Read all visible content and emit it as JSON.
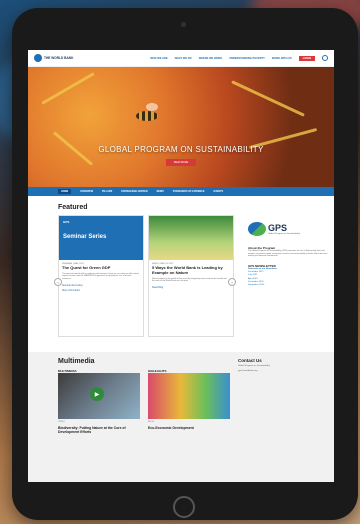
{
  "header": {
    "logo_text": "THE WORLD BANK",
    "nav": [
      "WHO WE ARE",
      "WHAT WE DO",
      "WHERE WE WORK",
      "UNDERSTANDING POVERTY",
      "WORK WITH US"
    ],
    "donate": "LOGIN"
  },
  "hero": {
    "title": "GLOBAL PROGRAM ON SUSTAINABILITY",
    "button": "READ MORE"
  },
  "subnav": [
    "HOME",
    "OVERVIEW",
    "PILLARS",
    "KNOWLEDGE CENTER",
    "NEWS",
    "STANDARDS OF EVIDENCE",
    "EVENTS"
  ],
  "featured": {
    "title": "Featured",
    "cards": [
      {
        "badge": "GPS",
        "image_text": "Seminar Series",
        "meta": "WEBINAR | MAY 2021",
        "title": "The Quest for Green GDP",
        "body": "The seminar formed with an audience with interest in how we can advance with natural capital accounts and the WAVES/GPS approach to adjusting for use of natural resources.",
        "link1": "Seminar Recording",
        "link2": "More Information"
      },
      {
        "meta": "NEWS | MAY 20 2021",
        "title": "5 Ways the World Bank is Leading by Example on Nature",
        "body": "Natural capital is the wealth of the poor. By integrating nature and natural capital into the work of the World Bank we can grow.",
        "link1": "Read Blog"
      }
    ]
  },
  "sidebar": {
    "gps_word": "GPS",
    "gps_sub": "Global Program on Sustainability",
    "about_title": "About the Program",
    "about_text": "The Global Program on Sustainability (GPS) promotes the use of high-quality data and analysis on natural capital, ecosystem services and sustainability to better inform decision making and financial investments.",
    "newsletter_title": "GPS NEWSLETTER",
    "subscribe": "Subscribe to our Newsletter",
    "issues": [
      "December 2021",
      "July 2021",
      "April 2021",
      "December 2020",
      "September 2020"
    ]
  },
  "multimedia": {
    "title": "Multimedia",
    "col1_label": "MULTIMEDIA",
    "col1_meta": "VIDEO",
    "col1_title": "Biodiversity: Putting Nature at the Core of Development Efforts",
    "col2_label": "HIGHLIGHTS",
    "col2_meta": "BLOG",
    "col2_title": "Eco-Economic Development",
    "contact_title": "Contact Us",
    "contact_text": "Global Program on Sustainability",
    "contact_email": "gps@worldbank.org"
  }
}
